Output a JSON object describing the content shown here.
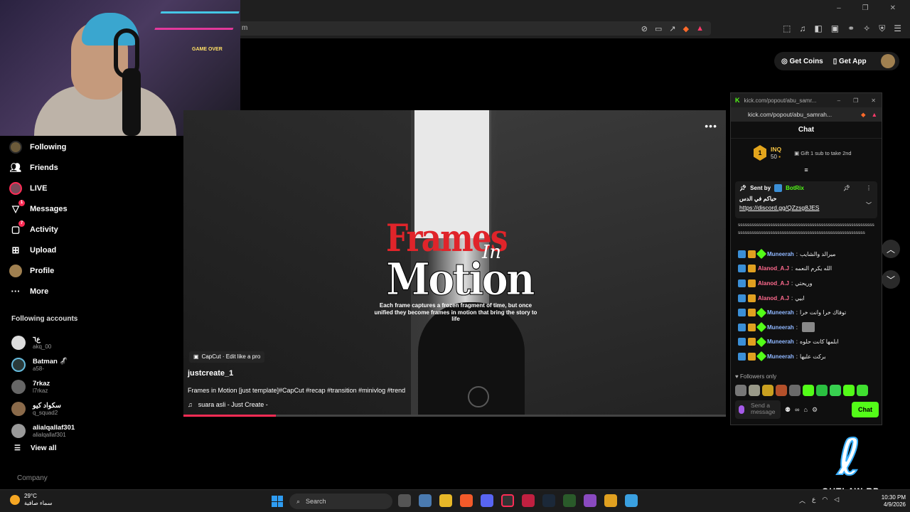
{
  "browser": {
    "url_fragment": "m",
    "toolbar_icons": [
      "mute-icon",
      "cast-icon",
      "share-icon",
      "brave-shield-icon",
      "brave-rewards-icon"
    ],
    "window_controls": [
      "–",
      "❐",
      "✕"
    ]
  },
  "header": {
    "get_coins_label": "Get Coins",
    "get_app_label": "Get App"
  },
  "webcam": {
    "sign_text": "GAME OVER"
  },
  "nav": {
    "items": [
      {
        "label": "Following",
        "icon": "following-avatar-icon"
      },
      {
        "label": "Friends",
        "icon": "friends-icon"
      },
      {
        "label": "LIVE",
        "icon": "live-icon"
      },
      {
        "label": "Messages",
        "icon": "messages-icon",
        "badge": "1"
      },
      {
        "label": "Activity",
        "icon": "activity-icon",
        "badge": "7"
      },
      {
        "label": "Upload",
        "icon": "upload-icon"
      },
      {
        "label": "Profile",
        "icon": "profile-avatar-icon"
      },
      {
        "label": "More",
        "icon": "more-icon"
      }
    ],
    "following_title": "Following accounts",
    "accounts": [
      {
        "name": "ع٦",
        "handle": "akq_00"
      },
      {
        "name": "Batman 🦨",
        "handle": "a58-"
      },
      {
        "name": "7rkaz",
        "handle": "l7rkaz"
      },
      {
        "name": "سكواد كيو",
        "handle": "q_squad2"
      },
      {
        "name": "alialqallaf301",
        "handle": "alialqallaf301"
      }
    ],
    "view_all": "View all",
    "company": "Company"
  },
  "video": {
    "title_frames": "Frames",
    "title_in": "In",
    "title_motion": "Motion",
    "tagline": "Each frame captures a frozen fragment of time, but once unified they become frames in motion that bring the story to life",
    "capcut_chip": "CapCut · Edit like a pro",
    "creator": "justcreate_1",
    "caption": "Frames in Motion [just template]#CapCut #recap #transition #minivlog #trend",
    "sound": "suara asli - Just Create -",
    "progress": 0.17,
    "more": "•••"
  },
  "chat": {
    "popout_title": "kick.com/popout/abu_samr...",
    "popout_url": "kick.com/popout/abu_samrah...",
    "header": "Chat",
    "leader": {
      "rank": "1",
      "name": "INQ",
      "coins": "50"
    },
    "gift_text": "Gift 1 sub to take 2nd",
    "pinned": {
      "sent_by": "Sent by",
      "bot": "BotRix",
      "text": "حياكم في الدس",
      "link": "https://discord.gg/QZzsg8JES"
    },
    "spam": "ssssssssssssssssssssssssssssssssssssssssssssssssssssssssssssssssssssssssssssssssssssssssssssssssssssssssssssssssss",
    "messages": [
      {
        "user": "Muneerah",
        "color": "#8fb7ff",
        "text": "ميرالد والشايب",
        "badges": 3
      },
      {
        "user": "Alanod_A.J",
        "color": "#ff6a8e",
        "text": "الله يكرم النعمه",
        "badges": 2
      },
      {
        "user": "Alanod_A.J",
        "color": "#ff6a8e",
        "text": "وريحتي",
        "badges": 2
      },
      {
        "user": "Alanod_A.J",
        "color": "#ff6a8e",
        "text": "ابيي",
        "badges": 2
      },
      {
        "user": "Muneerah",
        "color": "#8fb7ff",
        "text": "توفاك خرا وانت خرا",
        "badges": 3
      },
      {
        "user": "Muneerah",
        "color": "#8fb7ff",
        "text": "",
        "badges": 3
      },
      {
        "user": "Muneerah",
        "color": "#8fb7ff",
        "text": "ابلمها كانت حلوه",
        "badges": 3
      },
      {
        "user": "Muneerah",
        "color": "#8fb7ff",
        "text": "بركت عليها",
        "badges": 3
      }
    ],
    "followers_only": "Followers only",
    "send_placeholder": "Send a message",
    "chat_button": "Chat"
  },
  "logo": {
    "text": "OUTLAW RP"
  },
  "taskbar": {
    "temp": "29°C",
    "weather_desc": "سماء صافية",
    "search_label": "Search",
    "time": "10:30 PM",
    "date": "4/9/2026",
    "tray_lang": "ع"
  },
  "colors": {
    "kick_green": "#53fc18",
    "tiktok_red": "#fe2c55"
  }
}
